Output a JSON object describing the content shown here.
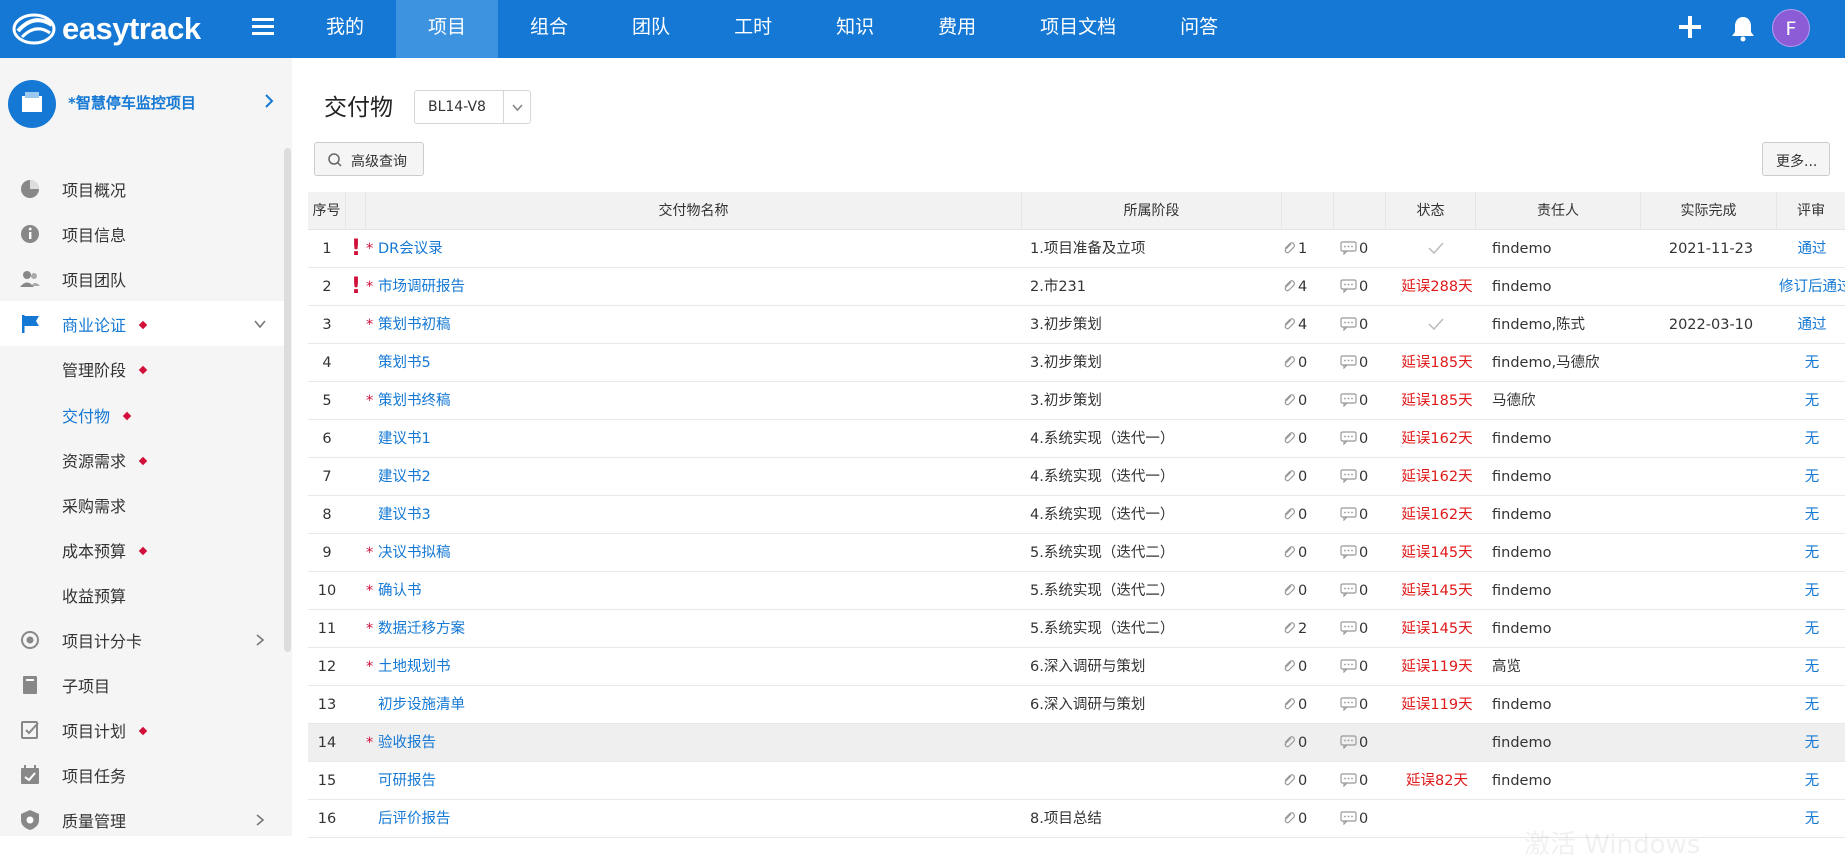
{
  "brand": {
    "logo_text": "easytrack"
  },
  "nav": {
    "items": [
      "我的",
      "项目",
      "组合",
      "团队",
      "工时",
      "知识",
      "费用",
      "项目文档",
      "问答"
    ],
    "active_index": 1
  },
  "user": {
    "avatar_initial": "F"
  },
  "sidebar": {
    "project_title": "*智慧停车监控项目",
    "menu": [
      {
        "label": "项目概况",
        "icon": "pie-chart-icon",
        "dot": false
      },
      {
        "label": "项目信息",
        "icon": "info-icon",
        "dot": false
      },
      {
        "label": "项目团队",
        "icon": "users-icon",
        "dot": false
      },
      {
        "label": "商业论证",
        "icon": "flag-icon",
        "dot": true
      },
      {
        "label": "管理阶段",
        "dot": true
      },
      {
        "label": "交付物",
        "dot": true
      },
      {
        "label": "资源需求",
        "dot": true
      },
      {
        "label": "采购需求",
        "dot": false
      },
      {
        "label": "成本预算",
        "dot": true
      },
      {
        "label": "收益预算",
        "dot": false
      },
      {
        "label": "项目计分卡",
        "icon": "target-icon",
        "dot": false
      },
      {
        "label": "子项目",
        "icon": "book-icon",
        "dot": false
      },
      {
        "label": "项目计划",
        "icon": "plan-icon",
        "dot": true
      },
      {
        "label": "项目任务",
        "icon": "calendar-check-icon",
        "dot": false
      },
      {
        "label": "质量管理",
        "icon": "shield-icon",
        "dot": false
      }
    ]
  },
  "main": {
    "page_title": "交付物",
    "version_value": "BL14-V8",
    "advanced_search_label": "高级查询",
    "more_label": "更多...",
    "columns": {
      "idx": "序号",
      "name": "交付物名称",
      "stage": "所属阶段",
      "status": "状态",
      "owner": "责任人",
      "done": "实际完成",
      "review": "评审"
    },
    "rows": [
      {
        "idx": "1",
        "flag": "!",
        "star": "*",
        "name": "DR会议录",
        "stage": "1.项目准备及立项",
        "att": "1",
        "cmt": "0",
        "status": "",
        "status_check": true,
        "owner": "findemo",
        "done": "2021-11-23",
        "review": "通过"
      },
      {
        "idx": "2",
        "flag": "!",
        "star": "*",
        "name": "市场调研报告",
        "stage": "2.市231",
        "att": "4",
        "cmt": "0",
        "status": "延误288天",
        "status_check": false,
        "owner": "findemo",
        "done": "",
        "review": "修订后通过"
      },
      {
        "idx": "3",
        "flag": "",
        "star": "*",
        "name": "策划书初稿",
        "stage": "3.初步策划",
        "att": "4",
        "cmt": "0",
        "status": "",
        "status_check": true,
        "owner": "findemo,陈式",
        "done": "2022-03-10",
        "review": "通过"
      },
      {
        "idx": "4",
        "flag": "",
        "star": "",
        "name": "策划书5",
        "stage": "3.初步策划",
        "att": "0",
        "cmt": "0",
        "status": "延误185天",
        "status_check": false,
        "owner": "findemo,马德欣",
        "done": "",
        "review": "无"
      },
      {
        "idx": "5",
        "flag": "",
        "star": "*",
        "name": "策划书终稿",
        "stage": "3.初步策划",
        "att": "0",
        "cmt": "0",
        "status": "延误185天",
        "status_check": false,
        "owner": "马德欣",
        "done": "",
        "review": "无"
      },
      {
        "idx": "6",
        "flag": "",
        "star": "",
        "name": "建议书1",
        "stage": "4.系统实现（迭代一）",
        "att": "0",
        "cmt": "0",
        "status": "延误162天",
        "status_check": false,
        "owner": "findemo",
        "done": "",
        "review": "无"
      },
      {
        "idx": "7",
        "flag": "",
        "star": "",
        "name": "建议书2",
        "stage": "4.系统实现（迭代一）",
        "att": "0",
        "cmt": "0",
        "status": "延误162天",
        "status_check": false,
        "owner": "findemo",
        "done": "",
        "review": "无"
      },
      {
        "idx": "8",
        "flag": "",
        "star": "",
        "name": "建议书3",
        "stage": "4.系统实现（迭代一）",
        "att": "0",
        "cmt": "0",
        "status": "延误162天",
        "status_check": false,
        "owner": "findemo",
        "done": "",
        "review": "无"
      },
      {
        "idx": "9",
        "flag": "",
        "star": "*",
        "name": "决议书拟稿",
        "stage": "5.系统实现（迭代二）",
        "att": "0",
        "cmt": "0",
        "status": "延误145天",
        "status_check": false,
        "owner": "findemo",
        "done": "",
        "review": "无"
      },
      {
        "idx": "10",
        "flag": "",
        "star": "*",
        "name": "确认书",
        "stage": "5.系统实现（迭代二）",
        "att": "0",
        "cmt": "0",
        "status": "延误145天",
        "status_check": false,
        "owner": "findemo",
        "done": "",
        "review": "无"
      },
      {
        "idx": "11",
        "flag": "",
        "star": "*",
        "name": "数据迁移方案",
        "stage": "5.系统实现（迭代二）",
        "att": "2",
        "cmt": "0",
        "status": "延误145天",
        "status_check": false,
        "owner": "findemo",
        "done": "",
        "review": "无"
      },
      {
        "idx": "12",
        "flag": "",
        "star": "*",
        "name": "土地规划书",
        "stage": "6.深入调研与策划",
        "att": "0",
        "cmt": "0",
        "status": "延误119天",
        "status_check": false,
        "owner": "高览",
        "done": "",
        "review": "无"
      },
      {
        "idx": "13",
        "flag": "",
        "star": "",
        "name": "初步设施清单",
        "stage": "6.深入调研与策划",
        "att": "0",
        "cmt": "0",
        "status": "延误119天",
        "status_check": false,
        "owner": "findemo",
        "done": "",
        "review": "无"
      },
      {
        "idx": "14",
        "flag": "",
        "star": "*",
        "name": "验收报告",
        "stage": "",
        "att": "0",
        "cmt": "0",
        "status": "",
        "status_check": false,
        "owner": "findemo",
        "done": "",
        "review": "无",
        "highlight": true
      },
      {
        "idx": "15",
        "flag": "",
        "star": "",
        "name": "可研报告",
        "stage": "",
        "att": "0",
        "cmt": "0",
        "status": "延误82天",
        "status_check": false,
        "owner": "findemo",
        "done": "",
        "review": "无"
      },
      {
        "idx": "16",
        "flag": "",
        "star": "",
        "name": "后评价报告",
        "stage": "8.项目总结",
        "att": "0",
        "cmt": "0",
        "status": "",
        "status_check": false,
        "owner": "",
        "done": "",
        "review": "无"
      }
    ]
  },
  "colors": {
    "primary": "#1478d4",
    "nav_active": "#3d93e0",
    "danger": "#e01a1a",
    "avatar": "#8b5cd6"
  }
}
